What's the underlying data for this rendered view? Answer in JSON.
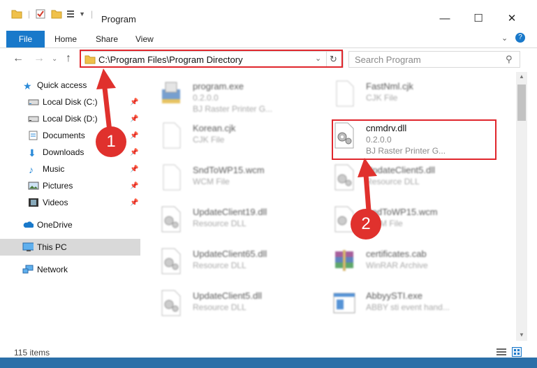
{
  "window": {
    "title": "Program",
    "controls": {
      "minimize": "—",
      "maximize": "☐",
      "close": "✕"
    }
  },
  "ribbon": {
    "tabs": [
      "File",
      "Home",
      "Share",
      "View"
    ]
  },
  "nav": {
    "address": "C:\\Program Files\\Program Directory",
    "search_placeholder": "Search Program"
  },
  "sidebar": {
    "items": [
      {
        "label": "Quick access",
        "icon": "star-icon",
        "pinned": false
      },
      {
        "label": "Local Disk (C:)",
        "icon": "drive-icon",
        "pinned": true
      },
      {
        "label": "Local Disk (D:)",
        "icon": "drive-icon",
        "pinned": true
      },
      {
        "label": "Documents",
        "icon": "documents-icon",
        "pinned": true
      },
      {
        "label": "Downloads",
        "icon": "download-icon",
        "pinned": true
      },
      {
        "label": "Music",
        "icon": "music-icon",
        "pinned": true
      },
      {
        "label": "Pictures",
        "icon": "pictures-icon",
        "pinned": true
      },
      {
        "label": "Videos",
        "icon": "videos-icon",
        "pinned": true
      },
      {
        "label": "OneDrive",
        "icon": "cloud-icon",
        "pinned": false
      },
      {
        "label": "This PC",
        "icon": "monitor-icon",
        "pinned": false,
        "selected": true
      },
      {
        "label": "Network",
        "icon": "network-icon",
        "pinned": false
      }
    ]
  },
  "files": [
    {
      "name": "program.exe",
      "line1": "0.2.0.0",
      "line2": "BJ Raster Printer G...",
      "kind": "exe"
    },
    {
      "name": "FastNml.cjk",
      "line1": "CJK File",
      "line2": "",
      "kind": "blank"
    },
    {
      "name": "Korean.cjk",
      "line1": "CJK File",
      "line2": "",
      "kind": "blank"
    },
    {
      "name": "cnmdrv.dll",
      "line1": "0.2.0.0",
      "line2": "BJ Raster Printer G...",
      "kind": "dll"
    },
    {
      "name": "SndToWP15.wcm",
      "line1": "WCM File",
      "line2": "",
      "kind": "blank"
    },
    {
      "name": "UpdateClient5.dll",
      "line1": "Resource DLL",
      "line2": "",
      "kind": "dll"
    },
    {
      "name": "UpdateClient19.dll",
      "line1": "Resource DLL",
      "line2": "",
      "kind": "dll"
    },
    {
      "name": "SndToWP15.wcm",
      "line1": "WCM File",
      "line2": "",
      "kind": "blank"
    },
    {
      "name": "UpdateClient65.dll",
      "line1": "Resource DLL",
      "line2": "",
      "kind": "dll"
    },
    {
      "name": "certificates.cab",
      "line1": "WinRAR Archive",
      "line2": "",
      "kind": "rar"
    },
    {
      "name": "UpdateClient5.dll",
      "line1": "Resource DLL",
      "line2": "",
      "kind": "dll"
    },
    {
      "name": "AbbyySTI.exe",
      "line1": "ABBY sti event hand...",
      "line2": "",
      "kind": "exe2"
    }
  ],
  "status": {
    "count": "115 items"
  },
  "annotations": {
    "badge1": "1",
    "badge2": "2"
  },
  "colors": {
    "accent": "#1979ca",
    "highlight": "#e0262c"
  }
}
